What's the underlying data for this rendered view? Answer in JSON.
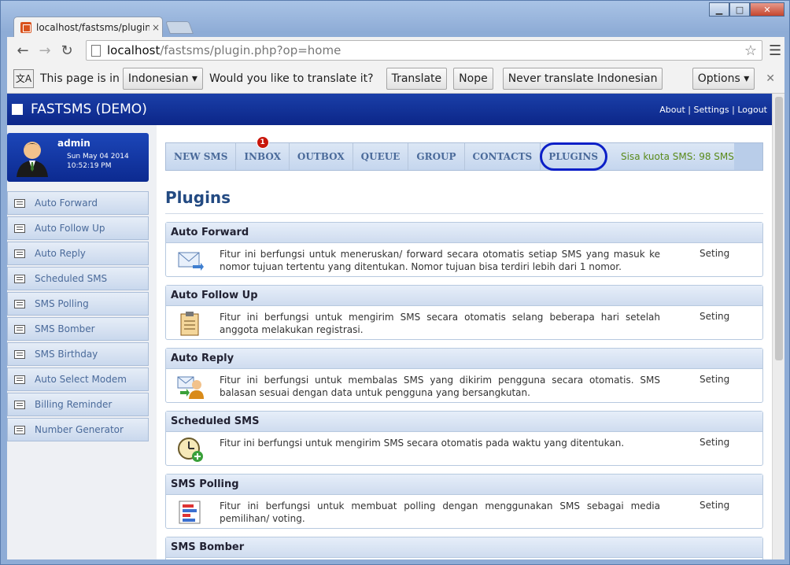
{
  "browser": {
    "tab_title": "localhost/fastsms/plugin.",
    "tab_close": "×",
    "url_host": "localhost",
    "url_path": "/fastsms/plugin.php?op=home",
    "window_buttons": {
      "minimize": "▁",
      "maximize": "□",
      "close": "✕"
    }
  },
  "translate_bar": {
    "prefix": "This page is in",
    "language": "Indonesian",
    "question": "Would you like to translate it?",
    "translate": "Translate",
    "nope": "Nope",
    "never": "Never translate Indonesian",
    "options": "Options"
  },
  "app": {
    "brand": "FASTSMS (DEMO)",
    "links": {
      "about": "About",
      "settings": "Settings",
      "logout": "Logout",
      "sep": " | "
    }
  },
  "user": {
    "name": "admin",
    "date": "Sun May 04 2014",
    "time": "10:52:19 PM"
  },
  "sidebar": {
    "items": [
      {
        "label": "Auto Forward"
      },
      {
        "label": "Auto Follow Up"
      },
      {
        "label": "Auto Reply"
      },
      {
        "label": "Scheduled SMS"
      },
      {
        "label": "SMS Polling"
      },
      {
        "label": "SMS Bomber"
      },
      {
        "label": "SMS Birthday"
      },
      {
        "label": "Auto Select Modem"
      },
      {
        "label": "Billing Reminder"
      },
      {
        "label": "Number Generator"
      }
    ]
  },
  "nav": {
    "tabs": [
      {
        "label": "NEW SMS"
      },
      {
        "label": "INBOX",
        "badge": "1"
      },
      {
        "label": "OUTBOX"
      },
      {
        "label": "QUEUE"
      },
      {
        "label": "GROUP"
      },
      {
        "label": "CONTACTS"
      },
      {
        "label": "PLUGINS"
      }
    ],
    "quota": "Sisa kuota SMS: 98 SMS"
  },
  "page": {
    "title": "Plugins"
  },
  "plugins": [
    {
      "name": "Auto Forward",
      "desc": "Fitur ini berfungsi untuk meneruskan/ forward secara otomatis setiap SMS yang masuk ke nomor tujuan tertentu yang ditentukan. Nomor tujuan bisa terdiri lebih dari 1 nomor.",
      "action": "Seting"
    },
    {
      "name": "Auto Follow Up",
      "desc": "Fitur ini berfungsi untuk mengirim SMS secara otomatis selang beberapa hari setelah anggota melakukan registrasi.",
      "action": "Seting"
    },
    {
      "name": "Auto Reply",
      "desc": "Fitur ini berfungsi untuk membalas SMS yang dikirim pengguna secara otomatis. SMS balasan sesuai dengan data untuk pengguna yang bersangkutan.",
      "action": "Seting"
    },
    {
      "name": "Scheduled SMS",
      "desc": "Fitur ini berfungsi untuk mengirim SMS secara otomatis pada waktu yang ditentukan.",
      "action": "Seting"
    },
    {
      "name": "SMS Polling",
      "desc": "Fitur ini berfungsi untuk membuat polling dengan menggunakan SMS sebagai media pemilihan/ voting.",
      "action": "Seting"
    },
    {
      "name": "SMS Bomber",
      "desc": "",
      "action": ""
    }
  ],
  "colors": {
    "header_bg": "#0c2688",
    "nav_text": "#4a6a9a",
    "quota_text": "#5a8a1a",
    "badge": "#c8160b",
    "circle_annotation": "#0b1fc7"
  }
}
